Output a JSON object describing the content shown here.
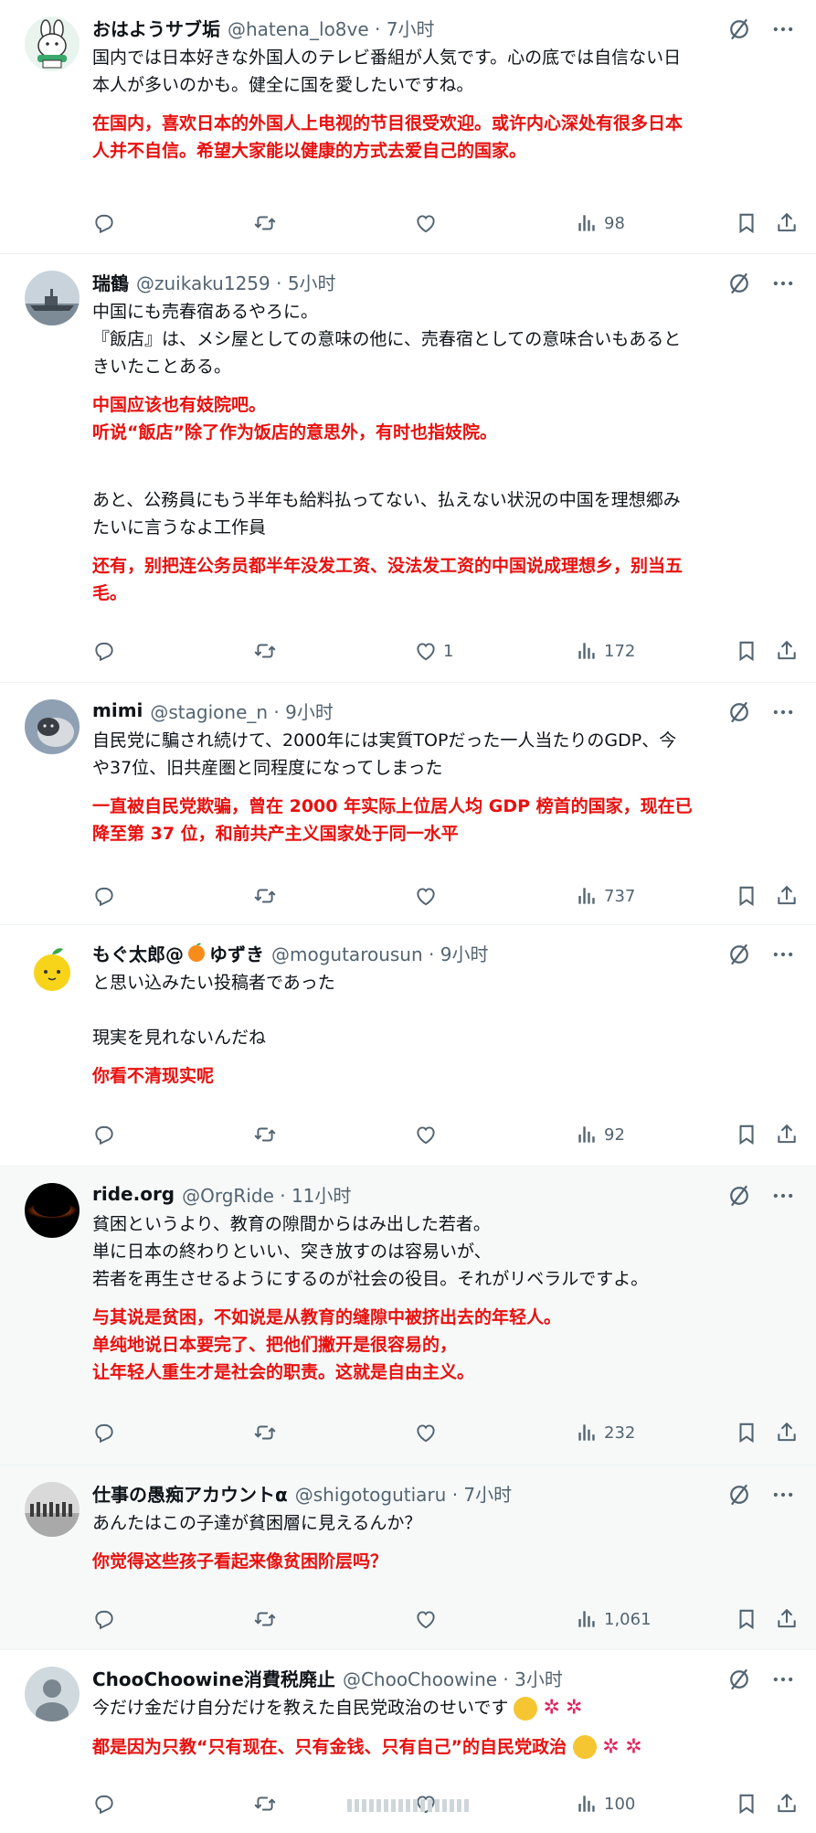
{
  "posts": [
    {
      "name": "おはようサブ垢",
      "handle": "@hatena_lo8ve · 7小时",
      "lines": [
        "国内では日本好きな外国人のテレビ番組が人気です。心の底では自信ない日",
        "本人が多いのかも。健全に国を愛したいですね。"
      ],
      "red_lines": [
        "在国内，喜欢日本的外国人上电视的节目很受欢迎。或许内心深处有很多日本",
        "人并不自信。希望大家能以健康的方式去爱自己的国家。"
      ],
      "likes": "",
      "views": "98"
    },
    {
      "name": "瑞鶴",
      "handle": "@zuikaku1259 · 5小时",
      "lines": [
        "中国にも売春宿あるやろに。",
        "『飯店』は、メシ屋としての意味の他に、売春宿としての意味合いもあると",
        "きいたことある。"
      ],
      "red_lines": [
        "中国应该也有妓院吧。",
        "听说“飯店”除了作为饭店的意思外，有时也指妓院。"
      ],
      "lines2": [
        "あと、公務員にもう半年も給料払ってない、払えない状況の中国を理想郷み",
        "たいに言うなよ工作員"
      ],
      "red_lines2": [
        "还有，别把连公务员都半年没发工资、没法发工资的中国说成理想乡，别当五",
        "毛。"
      ],
      "likes": "1",
      "views": "172"
    },
    {
      "name": "mimi",
      "handle": "@stagione_n · 9小时",
      "lines": [
        "自民党に騙され続けて、2000年には実質TOPだった一人当たりのGDP、今",
        "や37位、旧共産圏と同程度になってしまった"
      ],
      "red_lines": [
        "一直被自民党欺骗，曾在 2000 年实际上位居人均 GDP 榜首的国家，现在已",
        "降至第 37 位，和前共产主义国家处于同一水平"
      ],
      "likes": "",
      "views": "737"
    },
    {
      "name": "もぐ太郎@",
      "name_suffix": "ゆずき",
      "handle": "@mogutarousun · 9小时",
      "lines": [
        "と思い込みたい投稿者であった"
      ],
      "lines2": [
        "現実を見れないんだね"
      ],
      "red_lines": [
        "你看不清现实呢"
      ],
      "likes": "",
      "views": "92"
    },
    {
      "name": "ride.org",
      "handle": "@OrgRide · 11小时",
      "lines": [
        "貧困というより、教育の隙間からはみ出した若者。",
        "単に日本の終わりといい、突き放すのは容易いが、",
        "若者を再生させるようにするのが社会の役目。それがリベラルですよ。"
      ],
      "red_lines": [
        "与其说是贫困，不如说是从教育的缝隙中被挤出去的年轻人。",
        "单纯地说日本要完了、把他们撇开是很容易的，",
        "让年轻人重生才是社会的职责。这就是自由主义。"
      ],
      "likes": "",
      "views": "232"
    },
    {
      "name": "仕事の愚痴アカウントα",
      "handle": "@shigotogutiaru · 7小时",
      "lines": [
        "あんたはこの子達が貧困層に見えるんか？"
      ],
      "red_lines": [
        "你觉得这些孩子看起来像贫困阶层吗？"
      ],
      "likes": "",
      "views": "1,061"
    },
    {
      "name": "ChooChoowine消費税廃止",
      "handle": "@ChooChoowine · 3小时",
      "lines": [
        "今だけ金だけ自分だけを教えた自民党政治のせいです"
      ],
      "red_lines": [
        "都是因为只教“只有现在、只有金钱、只有自己”的自民党政治"
      ],
      "likes": "",
      "views": "100"
    }
  ],
  "icons": {
    "reply": "reply-icon",
    "retweet": "retweet-icon",
    "like": "heart-icon",
    "views": "views-icon",
    "bookmark": "bookmark-icon",
    "share": "share-icon",
    "grok": "grok-icon",
    "more": "more-icon"
  },
  "colors": {
    "translation_red": "#e8110f",
    "muted": "#536471",
    "highlight_bg": "#f7f9f9"
  }
}
